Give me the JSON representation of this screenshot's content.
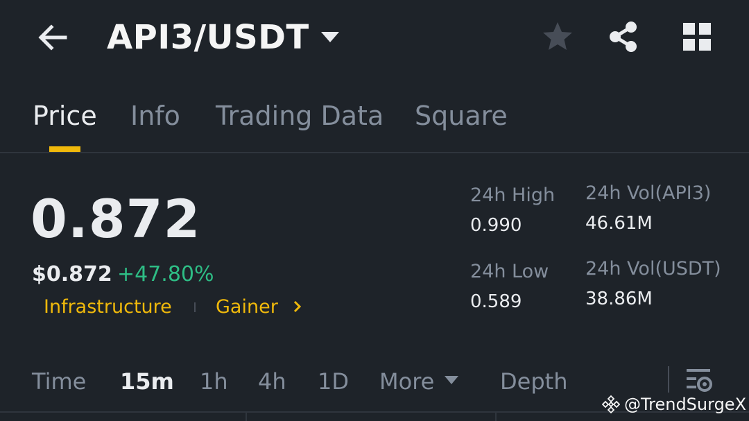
{
  "header": {
    "pair": "API3/USDT",
    "back_icon": "back-arrow-icon",
    "dropdown_icon": "caret-down-icon",
    "favorite_icon": "star-icon",
    "share_icon": "share-icon",
    "layout_icon": "grid-icon"
  },
  "tabs": [
    {
      "label": "Price",
      "active": true
    },
    {
      "label": "Info",
      "active": false
    },
    {
      "label": "Trading Data",
      "active": false
    },
    {
      "label": "Square",
      "active": false
    }
  ],
  "price": {
    "last": "0.872",
    "usd": "$0.872",
    "change": "+47.80%",
    "tags": [
      "Infrastructure",
      "Gainer"
    ]
  },
  "stats": {
    "high_label": "24h High",
    "high_value": "0.990",
    "low_label": "24h Low",
    "low_value": "0.589",
    "vol_base_label": "24h Vol(API3)",
    "vol_base_value": "46.61M",
    "vol_quote_label": "24h Vol(USDT)",
    "vol_quote_value": "38.86M"
  },
  "intervals": [
    {
      "label": "Time",
      "active": false
    },
    {
      "label": "15m",
      "active": true
    },
    {
      "label": "1h",
      "active": false
    },
    {
      "label": "4h",
      "active": false
    },
    {
      "label": "1D",
      "active": false
    },
    {
      "label": "More",
      "active": false
    },
    {
      "label": "Depth",
      "active": false
    }
  ],
  "watermark": "@TrendSurgeX",
  "colors": {
    "background": "#1e2329",
    "accent": "#f0b90b",
    "positive": "#2ebd85",
    "muted": "#848e9c",
    "text": "#eaecef"
  }
}
